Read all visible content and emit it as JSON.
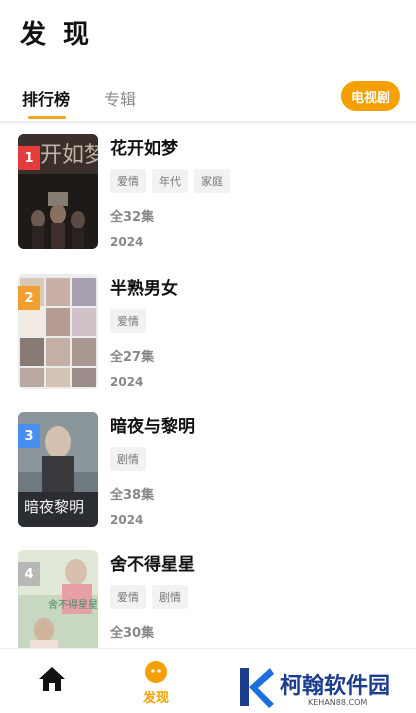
{
  "page": {
    "title": "发 现"
  },
  "tabs": [
    {
      "label": "排行榜",
      "active": true
    },
    {
      "label": "专辑",
      "active": false
    }
  ],
  "filter": {
    "label": "电视剧",
    "color": "#f5a000"
  },
  "items": [
    {
      "rank": "1",
      "rank_color": "#e63b3b",
      "title": "花开如梦",
      "tags": [
        "爱情",
        "年代",
        "家庭"
      ],
      "episodes": "全32集",
      "year": "2024"
    },
    {
      "rank": "2",
      "rank_color": "#f0a030",
      "title": "半熟男女",
      "tags": [
        "爱情"
      ],
      "episodes": "全27集",
      "year": "2024"
    },
    {
      "rank": "3",
      "rank_color": "#4a8ff0",
      "title": "暗夜与黎明",
      "tags": [
        "剧情"
      ],
      "episodes": "全38集",
      "year": "2024"
    },
    {
      "rank": "4",
      "rank_color": "#b8b8b8",
      "title": "舍不得星星",
      "tags": [
        "爱情",
        "剧情"
      ],
      "episodes": "全30集",
      "year": ""
    }
  ],
  "bottom_nav": [
    {
      "label": "",
      "icon": "home-icon",
      "active": false
    },
    {
      "label": "发现",
      "icon": "discover-icon",
      "active": true
    }
  ],
  "watermark": {
    "name": "柯翰软件园",
    "url": "KEHAN88.COM",
    "color": "#1d3d8f"
  }
}
